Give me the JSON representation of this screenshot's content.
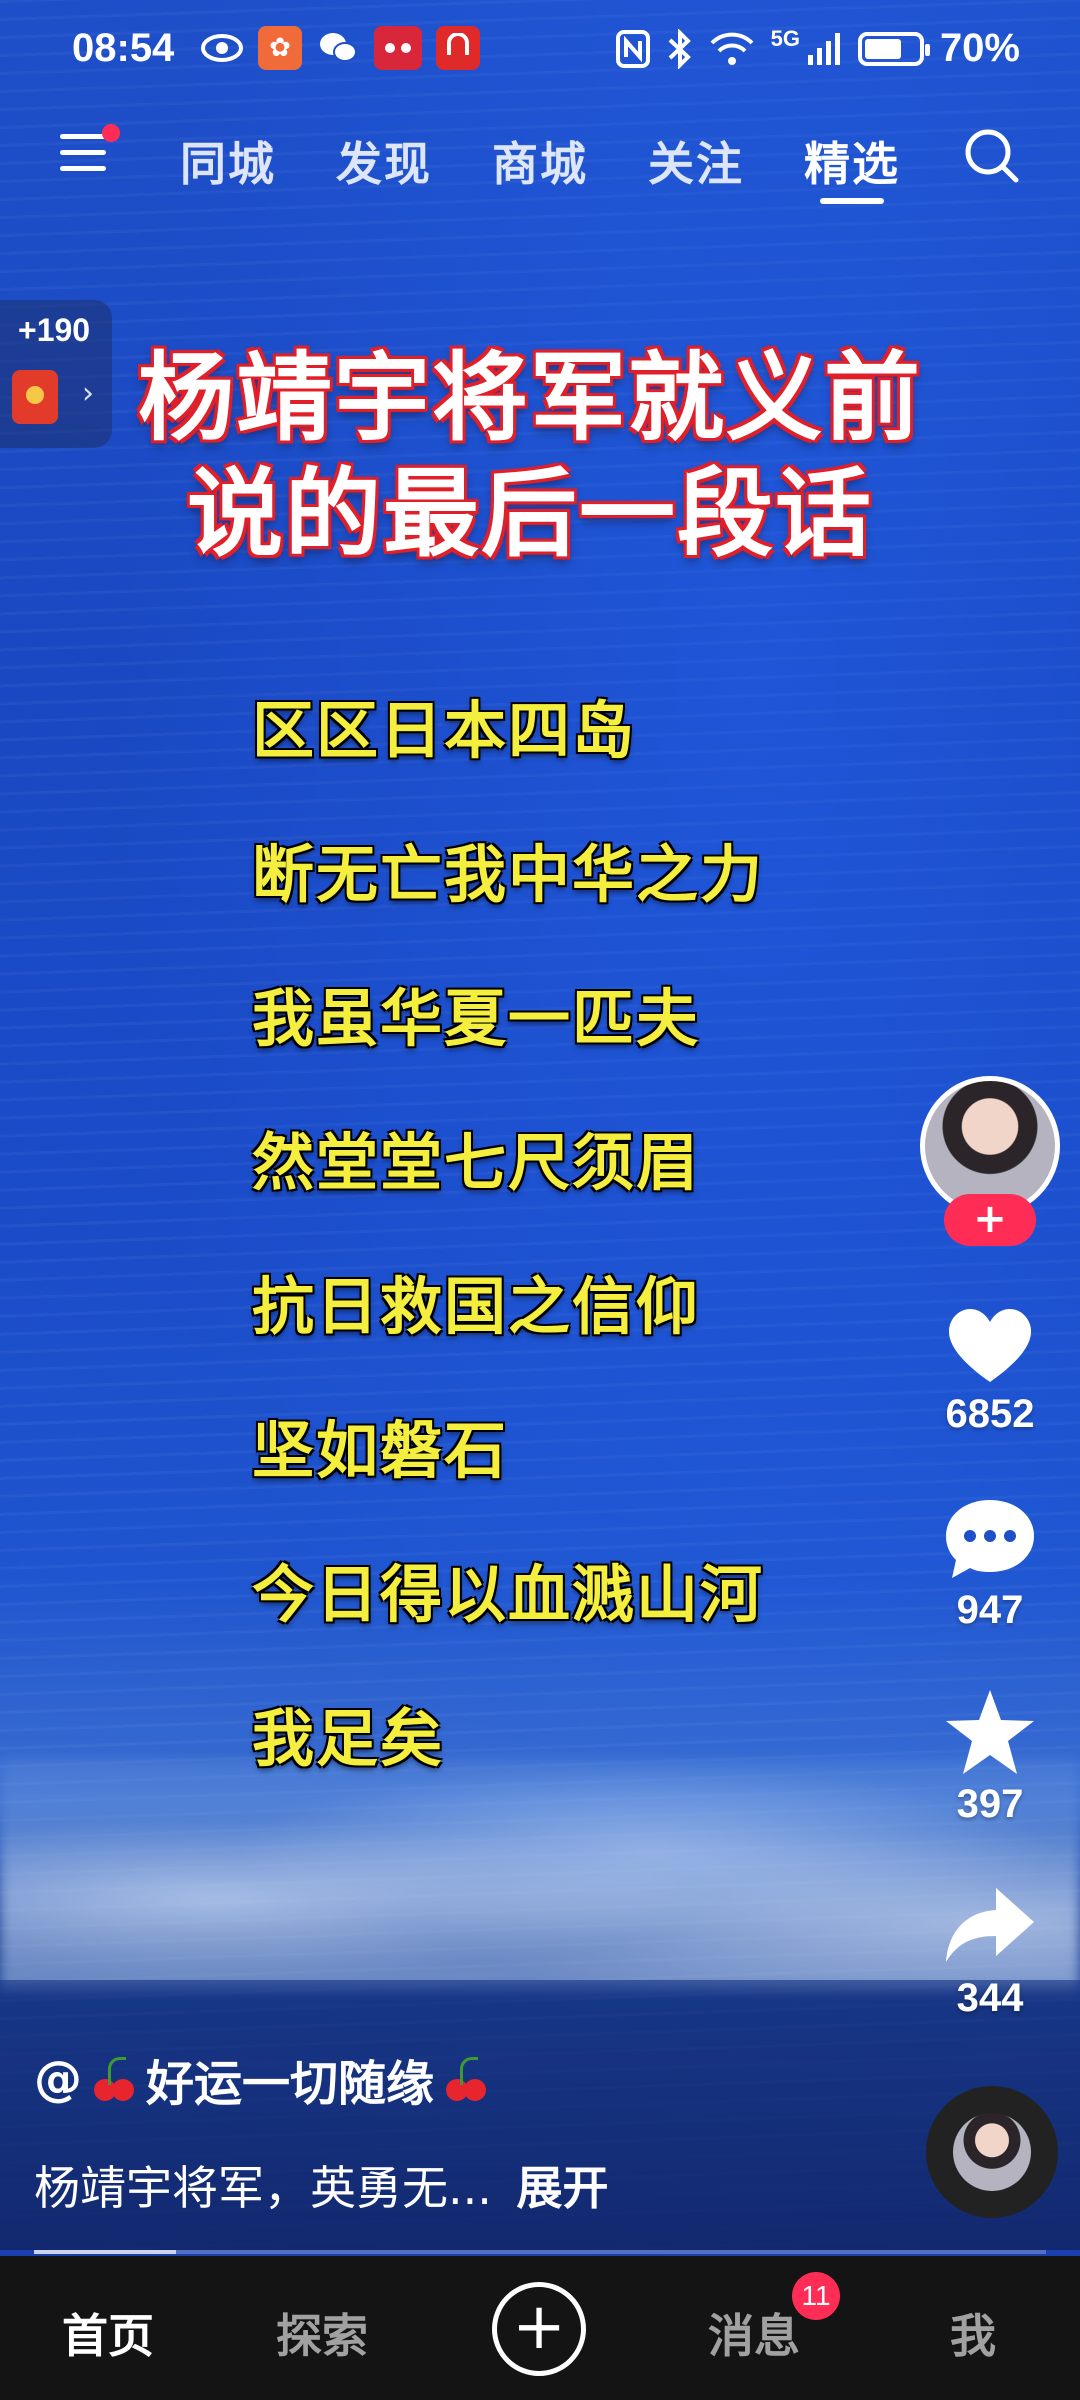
{
  "status_bar": {
    "time": "08:54",
    "battery": "70%",
    "battery_level": 0.7,
    "network": "5G",
    "app_icons": [
      "eye-icon",
      "app-icon",
      "wechat-icon",
      "tmall-icon",
      "listen-app-icon"
    ],
    "system_icons": [
      "nfc-icon",
      "bluetooth-icon",
      "wifi-icon",
      "signal-icon",
      "battery-icon"
    ]
  },
  "top_nav": {
    "tabs": [
      {
        "label": "同城",
        "active": false
      },
      {
        "label": "发现",
        "active": false
      },
      {
        "label": "商城",
        "active": false
      },
      {
        "label": "关注",
        "active": false
      },
      {
        "label": "精选",
        "active": true
      }
    ]
  },
  "reward": {
    "points": "+190"
  },
  "video": {
    "title_lines": [
      "杨靖宇将军就义前",
      "说的最后一段话"
    ],
    "poem_lines": [
      "区区日本四岛",
      "断无亡我中华之力",
      "我虽华夏一匹夫",
      "然堂堂七尺须眉",
      "抗日救国之信仰",
      "坚如磐石",
      "今日得以血溅山河",
      "我足矣"
    ]
  },
  "actions": {
    "follow_label": "+",
    "likes": "6852",
    "comments": "947",
    "favorites": "397",
    "shares": "344"
  },
  "author": {
    "prefix": "@",
    "name": "好运一切随缘"
  },
  "caption": {
    "text": "杨靖宇将军，英勇无...",
    "expand": "展开"
  },
  "progress": 0.14,
  "bottom_nav": {
    "home": "首页",
    "explore": "探索",
    "add": "+",
    "messages": "消息",
    "messages_badge": "11",
    "me": "我"
  },
  "colors": {
    "title_stroke": "#e0202a",
    "poem_text": "#f4ee3f",
    "accent": "#ff2d55",
    "ocean": "#1e4fc9"
  }
}
